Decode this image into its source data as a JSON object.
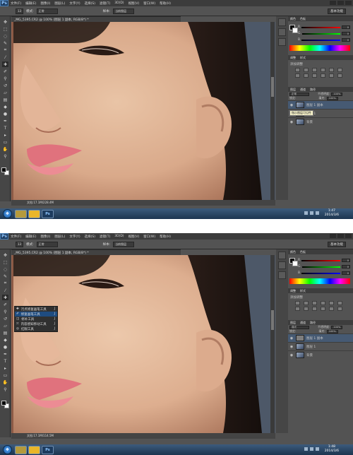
{
  "app": {
    "logo": "Ps",
    "menus": [
      "文件(F)",
      "编辑(E)",
      "图像(I)",
      "图层(L)",
      "文字(Y)",
      "选择(S)",
      "滤镜(T)",
      "3D(D)",
      "视图(V)",
      "窗口(W)",
      "帮助(H)"
    ]
  },
  "options": {
    "mode_label": "模式:",
    "mode_value": "正常",
    "sample_label": "样本:",
    "sample_value": "当前图层",
    "brush_size": "13",
    "workspace": "基本功能"
  },
  "screens": [
    {
      "doc_title": "_MG_5395.CR2 @ 100% (图层 1 副本, RGB/8*) *",
      "status": [
        "文档:17.1M/228.4M"
      ],
      "adjust_label": "添加调整",
      "layers_tabs": [
        "图层",
        "通道",
        "路径"
      ],
      "blend_mode": "正常",
      "opacity_label": "不透明度:",
      "opacity": "100%",
      "lock_label": "锁定:",
      "fill_label": "填充:",
      "fill": "100%",
      "layers": [
        {
          "name": "图层 1 副本",
          "selected": true
        },
        {
          "name": "图层 1",
          "selected": false
        },
        {
          "name": "背景",
          "selected": false
        }
      ],
      "tooltip": "指示图层可见性",
      "taskbar_apps": [
        "",
        "",
        "Ps"
      ],
      "clock": {
        "time": "1:47",
        "date": "2014/3/6"
      }
    },
    {
      "doc_title": "_MG_5395.CR2 @ 100% (图层 1 副本, RGB/8*) *",
      "status": [
        "文档:17.1M/114.5M"
      ],
      "adjust_label": "添加调整",
      "layers_tabs": [
        "图层",
        "通道",
        "路径"
      ],
      "blend_mode": "强光",
      "opacity_label": "不透明度:",
      "opacity": "100%",
      "lock_label": "锁定:",
      "fill_label": "填充:",
      "fill": "100%",
      "layers": [
        {
          "name": "图层 1 副本",
          "selected": true
        },
        {
          "name": "图层 1",
          "selected": false
        },
        {
          "name": "背景",
          "selected": false
        }
      ],
      "tool_menu": [
        {
          "label": "污点修复画笔工具",
          "key": "J",
          "selected": false
        },
        {
          "label": "修复画笔工具",
          "key": "J",
          "selected": true
        },
        {
          "label": "修补工具",
          "key": "J",
          "selected": false
        },
        {
          "label": "内容感知移动工具",
          "key": "J",
          "selected": false
        },
        {
          "label": "红眼工具",
          "key": "J",
          "selected": false
        }
      ],
      "taskbar_apps": [
        "",
        "",
        "Ps"
      ],
      "clock": {
        "time": "1:48",
        "date": "2014/3/6"
      }
    }
  ],
  "colors": {
    "r": "0",
    "g": "0",
    "b": "0",
    "r_label": "R",
    "g_label": "G",
    "b_label": "B",
    "slider_red": "#c83030",
    "slider_green": "#2f9a2f",
    "slider_blue": "#2f3fc0",
    "panel_bg": "#535353",
    "selected_layer": "#465a73"
  }
}
